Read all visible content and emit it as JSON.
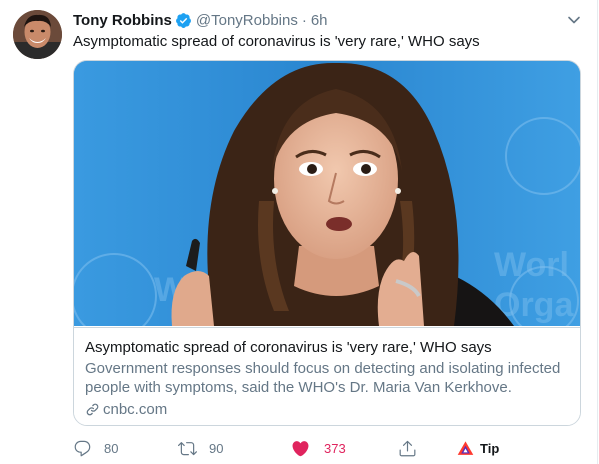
{
  "author": {
    "display_name": "Tony Robbins",
    "handle": "@TonyRobbins",
    "separator": "·",
    "time": "6h",
    "verified": true
  },
  "tweet": {
    "text": "Asymptomatic spread of coronavirus is 'very rare,' WHO says"
  },
  "card": {
    "title": "Asymptomatic spread of coronavirus is 'very rare,' WHO says",
    "description": "Government responses should focus on detecting and isolating infected people with symptoms, said the WHO's Dr. Maria Van Kerkhove.",
    "domain": "cnbc.com",
    "image_alt": "Woman speaking in front of a blue World Health Organization backdrop"
  },
  "actions": {
    "reply_count": "80",
    "retweet_count": "90",
    "like_count": "373",
    "tip_label": "Tip"
  },
  "colors": {
    "like_active": "#e0245e",
    "verified": "#1da1f2",
    "muted": "#657786",
    "border": "#ccd6dd"
  },
  "icons": [
    "verified-badge-icon",
    "chevron-down-icon",
    "link-icon",
    "reply-icon",
    "retweet-icon",
    "heart-icon",
    "share-icon",
    "tip-icon"
  ]
}
